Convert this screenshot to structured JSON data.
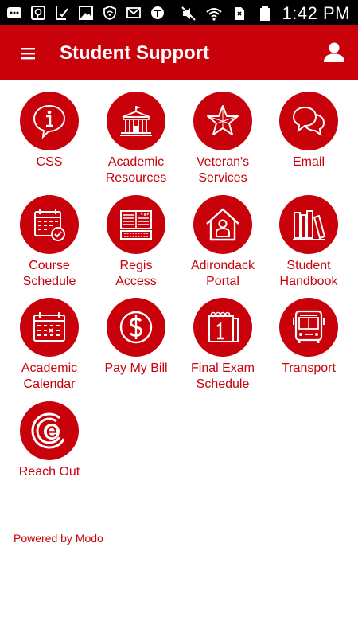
{
  "status_bar": {
    "time": "1:42 PM",
    "icons": [
      "more-icon",
      "messenger-icon",
      "clipboard-check-icon",
      "image-icon",
      "shield-wifi-icon",
      "email-icon",
      "translate-icon",
      "mute-icon",
      "wifi-icon",
      "sim-icon",
      "battery-icon"
    ]
  },
  "app_bar": {
    "title": "Student Support",
    "menu_icon": "hamburger-menu-icon",
    "profile_icon": "person-icon"
  },
  "tiles": [
    {
      "label": "CSS",
      "icon": "info-speech-icon"
    },
    {
      "label": "Academic\nResources",
      "icon": "building-icon"
    },
    {
      "label": "Veteran's\nServices",
      "icon": "star-icon"
    },
    {
      "label": "Email",
      "icon": "chat-bubbles-icon"
    },
    {
      "label": "Course\nSchedule",
      "icon": "calendar-check-icon"
    },
    {
      "label": "Regis\nAccess",
      "icon": "book-keyboard-icon"
    },
    {
      "label": "Adirondack\nPortal",
      "icon": "house-person-icon"
    },
    {
      "label": "Student\nHandbook",
      "icon": "books-icon"
    },
    {
      "label": "Academic\nCalendar",
      "icon": "calendar-icon"
    },
    {
      "label": "Pay My Bill",
      "icon": "dollar-icon"
    },
    {
      "label": "Final Exam\nSchedule",
      "icon": "notepad-icon"
    },
    {
      "label": "Transport",
      "icon": "bus-icon"
    },
    {
      "label": "Reach Out",
      "icon": "reach-out-logo-icon"
    }
  ],
  "footer": {
    "text": "Powered by Modo"
  },
  "colors": {
    "accent": "#c8010b",
    "status_bar": "#000000",
    "background": "#ffffff"
  }
}
